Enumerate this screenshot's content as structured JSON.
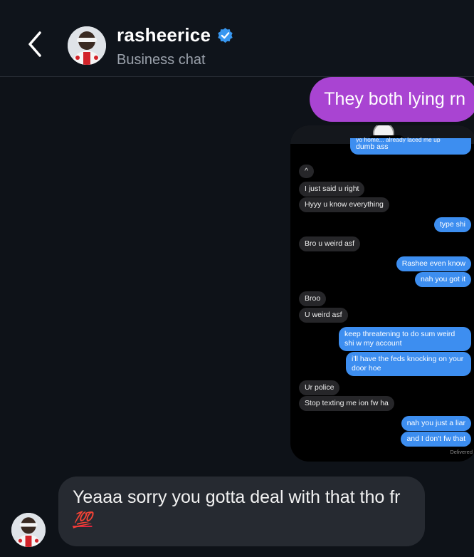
{
  "header": {
    "username": "rasheerice",
    "subtitle": "Business chat",
    "back_icon": "chevron-left-icon",
    "verified_icon": "verified-badge-icon",
    "verified_color": "#3897f0"
  },
  "messages": {
    "sent_text": "They both lying rn",
    "sent_color": "#a944d2",
    "received_text": "Yeaaa sorry you gotta deal with that tho fr",
    "received_emoji": "💯"
  },
  "screenshot": {
    "cut_text": "yo home... already laced me up",
    "items": [
      {
        "dir": "out",
        "text": "dumb ass"
      },
      {
        "dir": "in",
        "text": "^"
      },
      {
        "dir": "in",
        "text": "I just said u right"
      },
      {
        "dir": "in",
        "text": "Hyyy u know everything"
      },
      {
        "dir": "out",
        "text": "type shi"
      },
      {
        "dir": "in",
        "text": "Bro u weird asf"
      },
      {
        "dir": "out",
        "text": "Rashee even know"
      },
      {
        "dir": "out",
        "text": "nah you got it"
      },
      {
        "dir": "in",
        "text": "Broo"
      },
      {
        "dir": "in",
        "text": "U weird asf"
      },
      {
        "dir": "out",
        "text": "keep threatening to do sum weird shi w my account"
      },
      {
        "dir": "out",
        "text": "i'll have the feds knocking on your door hoe"
      },
      {
        "dir": "in",
        "text": "Ur police"
      },
      {
        "dir": "in",
        "text": "Stop texting me ion fw ha"
      },
      {
        "dir": "out",
        "text": "nah you just a liar"
      },
      {
        "dir": "out",
        "text": "and I don't fw that"
      }
    ],
    "delivered": "Delivered",
    "out_color": "#3d8ef0",
    "in_color": "#262629"
  }
}
